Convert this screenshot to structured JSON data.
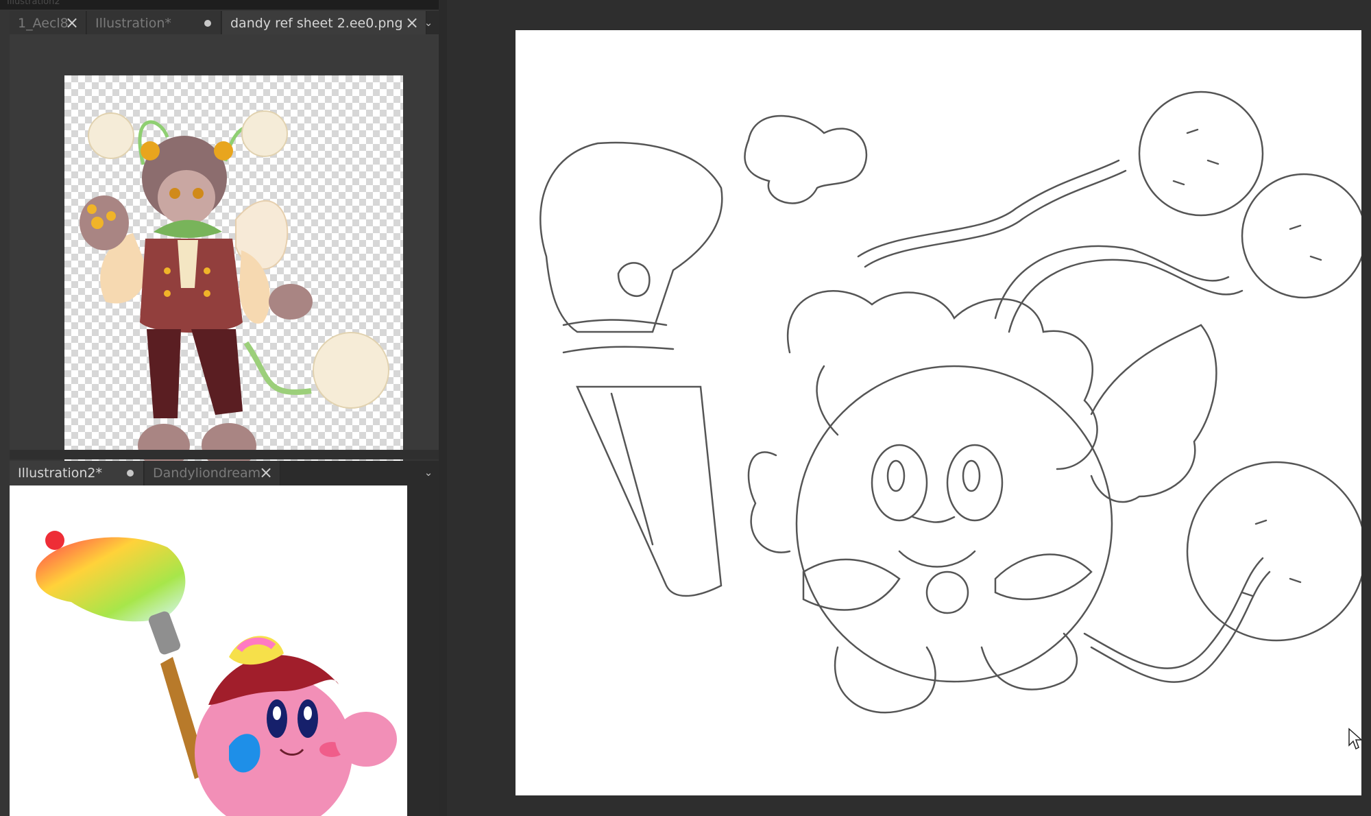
{
  "window": {
    "title_fragment": "Illustration2"
  },
  "top_panel": {
    "tabs": [
      {
        "label": "1_Aecl8",
        "state": "close"
      },
      {
        "label": "Illustration*",
        "state": "modified"
      },
      {
        "label": "dandy ref sheet 2.ee0.png",
        "state": "close",
        "active": true
      }
    ]
  },
  "bottom_panel": {
    "tabs": [
      {
        "label": "Illustration2*",
        "state": "modified",
        "active": true
      },
      {
        "label": "Dandyliondream",
        "state": "close"
      }
    ]
  },
  "icons": {
    "close": "×",
    "dropdown": "⌄",
    "modified_dot": "dot-icon"
  },
  "colors": {
    "panel_bg": "#353535",
    "tab_active": "#3c3c3c",
    "canvas_bg": "#2e2e2e",
    "paper": "#ffffff"
  }
}
